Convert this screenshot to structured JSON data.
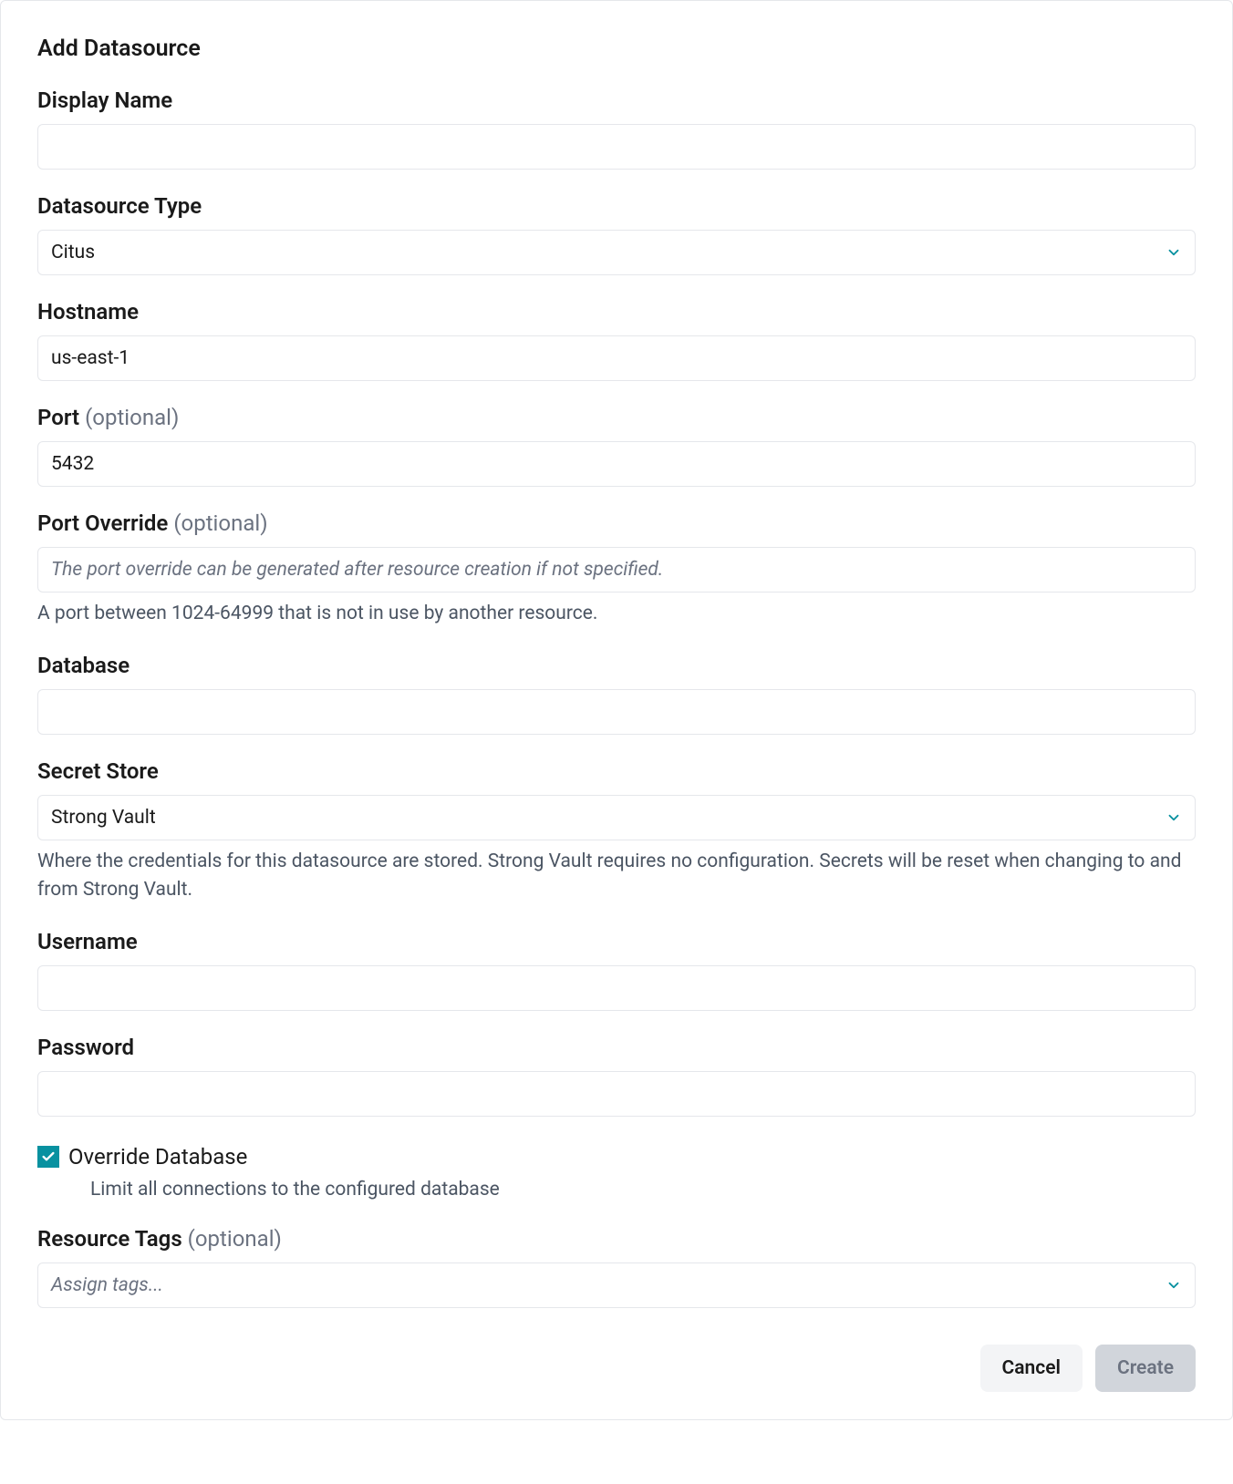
{
  "title": "Add Datasource",
  "display_name": {
    "label": "Display Name",
    "value": ""
  },
  "datasource_type": {
    "label": "Datasource Type",
    "value": "Citus"
  },
  "hostname": {
    "label": "Hostname",
    "value": "us-east-1"
  },
  "port": {
    "label": "Port ",
    "optional": "(optional)",
    "value": "5432"
  },
  "port_override": {
    "label": "Port Override ",
    "optional": "(optional)",
    "placeholder": "The port override can be generated after resource creation if not specified.",
    "help": "A port between 1024-64999 that is not in use by another resource."
  },
  "database": {
    "label": "Database",
    "value": ""
  },
  "secret_store": {
    "label": "Secret Store",
    "value": "Strong Vault",
    "help": "Where the credentials for this datasource are stored. Strong Vault requires no configuration. Secrets will be reset when changing to and from Strong Vault."
  },
  "username": {
    "label": "Username",
    "value": ""
  },
  "password": {
    "label": "Password",
    "value": ""
  },
  "override_db": {
    "label": "Override Database",
    "help": "Limit all connections to the configured database"
  },
  "resource_tags": {
    "label": "Resource Tags ",
    "optional": "(optional)",
    "placeholder": "Assign tags..."
  },
  "buttons": {
    "cancel": "Cancel",
    "create": "Create"
  }
}
